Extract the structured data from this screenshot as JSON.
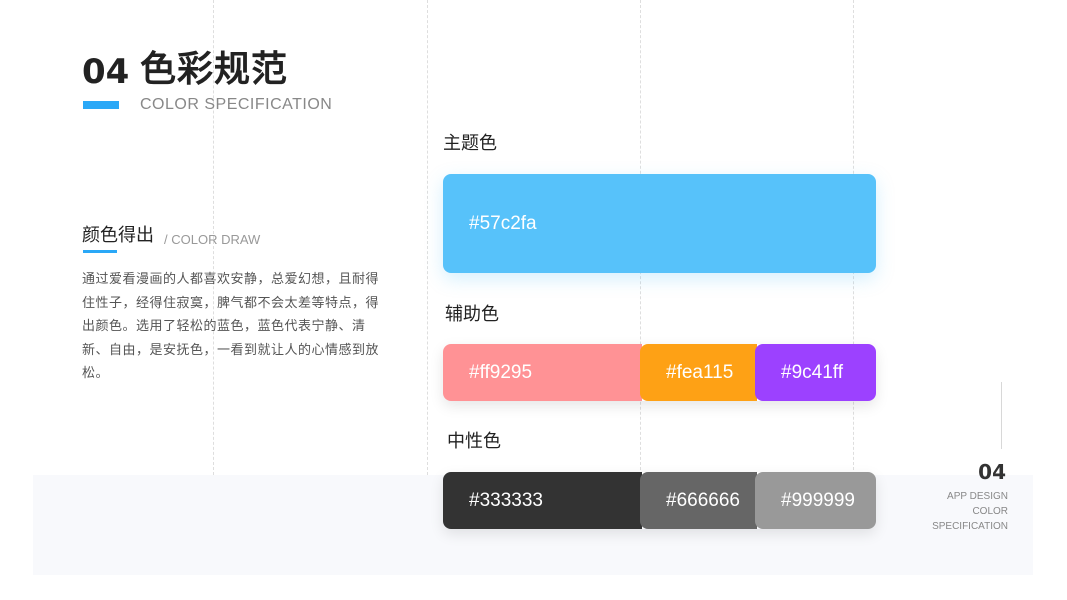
{
  "header": {
    "number": "04",
    "title": "色彩规范",
    "subtitle": "COLOR SPECIFICATION"
  },
  "section": {
    "title": "颜色得出",
    "subtitle": "/ COLOR DRAW",
    "body": "通过爱看漫画的人都喜欢安静，总爱幻想，且耐得住性子，经得住寂寞，脾气都不会太差等特点，得出颜色。选用了轻松的蓝色，蓝色代表宁静、清新、自由，是安抚色，一看到就让人的心情感到放松。"
  },
  "groups": {
    "main": {
      "label": "主题色",
      "colors": [
        {
          "hex": "#57c2fa",
          "label": "#57c2fa"
        }
      ]
    },
    "aux": {
      "label": "辅助色",
      "colors": [
        {
          "hex": "#ff9295",
          "label": "#ff9295"
        },
        {
          "hex": "#fea115",
          "label": "#fea115"
        },
        {
          "hex": "#9c41ff",
          "label": "#9c41ff"
        }
      ]
    },
    "neutral": {
      "label": "中性色",
      "colors": [
        {
          "hex": "#333333",
          "label": "#333333"
        },
        {
          "hex": "#666666",
          "label": "#666666"
        },
        {
          "hex": "#999999",
          "label": "#999999"
        }
      ]
    }
  },
  "footer": {
    "number": "04",
    "lines": [
      "APP DESIGN",
      "COLOR",
      "SPECIFICATION"
    ]
  },
  "accent_color": "#2aa8f7"
}
